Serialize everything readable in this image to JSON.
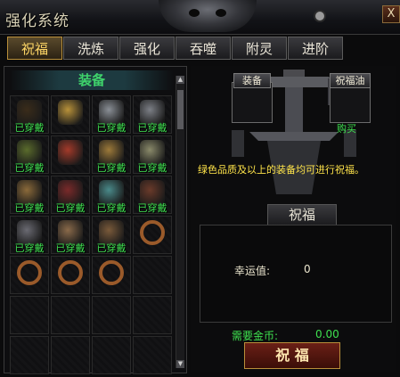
{
  "window": {
    "title": "强化系统",
    "close_label": "X"
  },
  "tabs": [
    {
      "label": "祝福",
      "active": true
    },
    {
      "label": "洗炼",
      "active": false
    },
    {
      "label": "强化",
      "active": false
    },
    {
      "label": "吞噬",
      "active": false
    },
    {
      "label": "附灵",
      "active": false
    },
    {
      "label": "进阶",
      "active": false
    }
  ],
  "equip_panel": {
    "header": "装备",
    "worn_tag": "已穿戴",
    "items": [
      {
        "icon": "dagger-icon",
        "worn": true
      },
      {
        "icon": "golden-blade-icon",
        "worn": false
      },
      {
        "icon": "mask-icon",
        "worn": true
      },
      {
        "icon": "helmet-icon",
        "worn": true
      },
      {
        "icon": "belt-icon",
        "worn": true
      },
      {
        "icon": "bow-icon",
        "worn": false
      },
      {
        "icon": "boots-icon",
        "worn": true
      },
      {
        "icon": "bead-belt-icon",
        "worn": true
      },
      {
        "icon": "dragon-helmet-icon",
        "worn": true
      },
      {
        "icon": "necklace-icon",
        "worn": true
      },
      {
        "icon": "amulet-icon",
        "worn": true
      },
      {
        "icon": "gauntlet-icon",
        "worn": true
      },
      {
        "icon": "bracer-icon",
        "worn": true
      },
      {
        "icon": "glove-icon",
        "worn": true
      },
      {
        "icon": "claw-icon",
        "worn": true
      },
      {
        "icon": "ring-icon",
        "worn": false
      },
      {
        "icon": "ring-icon",
        "worn": false
      },
      {
        "icon": "ring-icon",
        "worn": false
      },
      {
        "icon": "ring-icon",
        "worn": false
      },
      {
        "icon": "empty",
        "worn": false
      }
    ],
    "empty_rows": 2
  },
  "bless_panel": {
    "equip_slot_label": "装备",
    "oil_slot_label": "祝福油",
    "buy_link": "购买",
    "description": "绿色品质及以上的装备均可进行祝福。",
    "section_title": "祝福",
    "luck_label": "幸运值:",
    "luck_value": "0",
    "gold_label": "需要金币:",
    "gold_value": "0.00",
    "action_button": "祝 福"
  },
  "colors": {
    "accent": "#3ee04f",
    "gold": "#ffd766",
    "desc": "#ffe44a"
  }
}
